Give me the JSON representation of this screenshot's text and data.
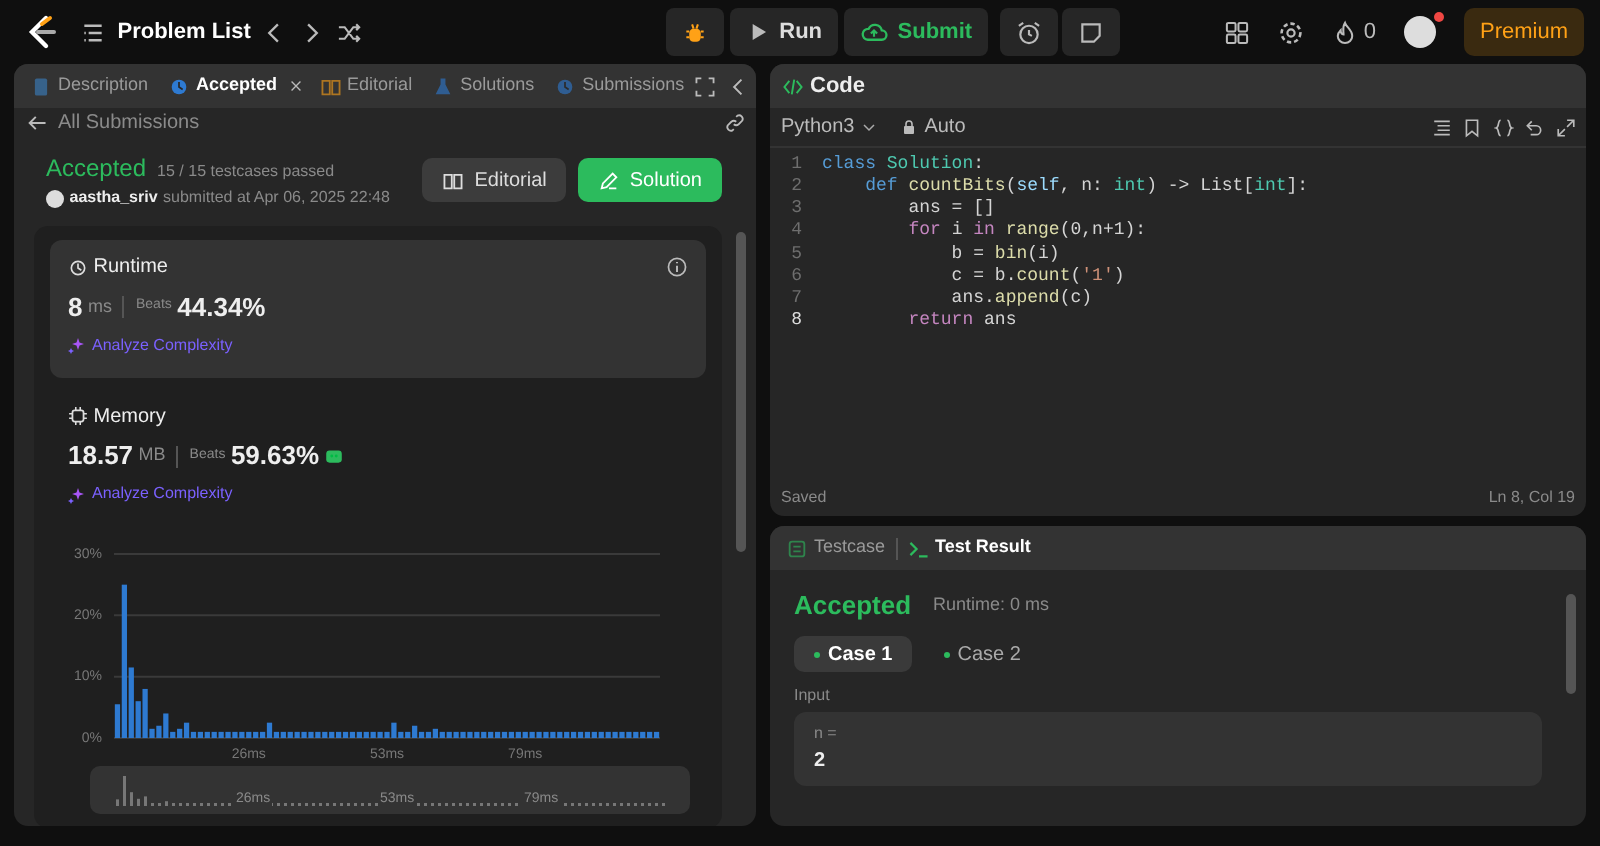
{
  "top_bar": {
    "title": "Problem List",
    "run_button": "Run",
    "submit_button": "Submit",
    "streak_count": "0",
    "avatar_notification": true,
    "premium_button": "Premium"
  },
  "left_panel": {
    "tabs": [
      {
        "label": "Description",
        "kind": "description",
        "selected": false,
        "closable": false
      },
      {
        "label": "Accepted",
        "kind": "accepted",
        "selected": true,
        "closable": true
      },
      {
        "label": "Editorial",
        "kind": "editorial",
        "selected": false,
        "closable": false
      },
      {
        "label": "Solutions",
        "kind": "solutions",
        "selected": false,
        "closable": false
      },
      {
        "label": "Submissions",
        "kind": "submissions",
        "selected": false,
        "closable": false
      }
    ],
    "back_link": "All Submissions",
    "status": "Accepted",
    "testcases": "15 / 15 testcases passed",
    "username": "aastha_sriv",
    "submitted_text": "submitted at Apr 06, 2025 22:48",
    "buttons": [
      {
        "label": "Editorial",
        "kind": "secondary"
      },
      {
        "label": "Solution",
        "kind": "primary"
      }
    ],
    "stats": [
      {
        "kind": "runtime",
        "title": "Runtime",
        "value": "8",
        "unit": "ms",
        "beats_label": "Beats",
        "beats": "44.34%",
        "analyze": "Analyze Complexity",
        "selected": true
      },
      {
        "kind": "memory",
        "title": "Memory",
        "value": "18.57",
        "unit": "MB",
        "beats_label": "Beats",
        "beats": "59.63%",
        "analyze": "Analyze Complexity",
        "selected": false
      }
    ],
    "chart_data": {
      "type": "bar",
      "ylim": [
        0,
        30
      ],
      "yticks": [
        {
          "value": 0,
          "label": "0%"
        },
        {
          "value": 10,
          "label": "10%"
        },
        {
          "value": 20,
          "label": "20%"
        },
        {
          "value": 30,
          "label": "30%"
        }
      ],
      "categories": [
        null,
        null,
        null,
        null,
        null,
        null,
        null,
        null,
        null,
        null,
        null,
        null,
        null,
        null,
        null,
        null,
        null,
        null,
        null,
        "26ms",
        null,
        null,
        null,
        null,
        null,
        null,
        null,
        null,
        null,
        null,
        null,
        null,
        null,
        null,
        null,
        null,
        null,
        null,
        null,
        "53ms",
        null,
        null,
        null,
        null,
        null,
        null,
        null,
        null,
        null,
        null,
        null,
        null,
        null,
        null,
        null,
        null,
        null,
        null,
        null,
        "79ms",
        null,
        null,
        null,
        null,
        null,
        null,
        null,
        null,
        null,
        null,
        null,
        null,
        null,
        null,
        null,
        null,
        null,
        null,
        null
      ],
      "values": [
        5.5,
        25,
        11.5,
        6,
        8,
        1.5,
        2,
        4,
        1,
        1.5,
        2.5,
        1,
        1,
        1,
        1,
        1,
        1,
        1,
        1,
        1,
        1,
        1,
        2.5,
        1,
        1,
        1,
        1,
        1,
        1,
        1,
        1,
        1,
        1,
        1,
        1,
        1,
        1,
        1,
        1,
        1,
        2.5,
        1,
        1,
        2,
        1,
        1,
        1.5,
        1,
        1,
        1,
        1,
        1,
        1,
        1,
        1,
        1,
        1,
        1,
        1,
        1,
        1,
        1,
        1,
        1,
        1,
        1,
        1,
        1,
        1,
        1,
        1,
        1,
        1,
        1,
        1,
        1,
        1,
        1,
        1
      ]
    },
    "overview_labels": [
      "26ms",
      "53ms",
      "79ms"
    ]
  },
  "code_panel": {
    "title": "Code",
    "language": "Python3",
    "mode": "Auto",
    "status": "Saved",
    "cursor": "Ln 8, Col 19",
    "lines": [
      {
        "number": "1",
        "current": false,
        "tokens": [
          {
            "text": "class ",
            "kind": "keyword"
          },
          {
            "text": "Solution",
            "kind": "type"
          },
          {
            "text": ":",
            "kind": "plain"
          }
        ]
      },
      {
        "number": "2",
        "current": false,
        "tokens": [
          {
            "text": "    def ",
            "kind": "keyword"
          },
          {
            "text": "countBits",
            "kind": "function"
          },
          {
            "text": "(",
            "kind": "plain"
          },
          {
            "text": "self",
            "kind": "param"
          },
          {
            "text": ", n: ",
            "kind": "plain"
          },
          {
            "text": "int",
            "kind": "type"
          },
          {
            "text": ") -> List[",
            "kind": "plain"
          },
          {
            "text": "int",
            "kind": "type"
          },
          {
            "text": "]:",
            "kind": "plain"
          }
        ]
      },
      {
        "number": "3",
        "current": false,
        "tokens": [
          {
            "text": "        ans = []",
            "kind": "plain"
          }
        ]
      },
      {
        "number": "4",
        "current": false,
        "tokens": [
          {
            "text": "        for",
            "kind": "control"
          },
          {
            "text": " i ",
            "kind": "plain"
          },
          {
            "text": "in ",
            "kind": "control"
          },
          {
            "text": "range",
            "kind": "function"
          },
          {
            "text": "(0,n+1):",
            "kind": "plain"
          }
        ]
      },
      {
        "number": "5",
        "current": false,
        "tokens": [
          {
            "text": "            b = ",
            "kind": "plain"
          },
          {
            "text": "bin",
            "kind": "function"
          },
          {
            "text": "(i)",
            "kind": "plain"
          }
        ]
      },
      {
        "number": "6",
        "current": false,
        "tokens": [
          {
            "text": "            c = b.",
            "kind": "plain"
          },
          {
            "text": "count",
            "kind": "function"
          },
          {
            "text": "(",
            "kind": "plain"
          },
          {
            "text": "'1'",
            "kind": "string"
          },
          {
            "text": ")",
            "kind": "plain"
          }
        ]
      },
      {
        "number": "7",
        "current": false,
        "tokens": [
          {
            "text": "            ans.",
            "kind": "plain"
          },
          {
            "text": "append",
            "kind": "function"
          },
          {
            "text": "(c)",
            "kind": "plain"
          }
        ]
      },
      {
        "number": "8",
        "current": true,
        "tokens": [
          {
            "text": "        return",
            "kind": "control"
          },
          {
            "text": " ans",
            "kind": "plain"
          }
        ]
      }
    ]
  },
  "result_panel": {
    "tabs": [
      {
        "label": "Testcase",
        "kind": "testcase",
        "selected": false
      },
      {
        "label": "Test Result",
        "kind": "result",
        "selected": true
      }
    ],
    "status": "Accepted",
    "runtime": "Runtime: 0 ms",
    "cases": [
      {
        "label": "Case 1",
        "selected": true
      },
      {
        "label": "Case 2",
        "selected": false
      }
    ],
    "input_label": "Input",
    "inputs": [
      {
        "name": "n =",
        "value": "2"
      }
    ]
  }
}
